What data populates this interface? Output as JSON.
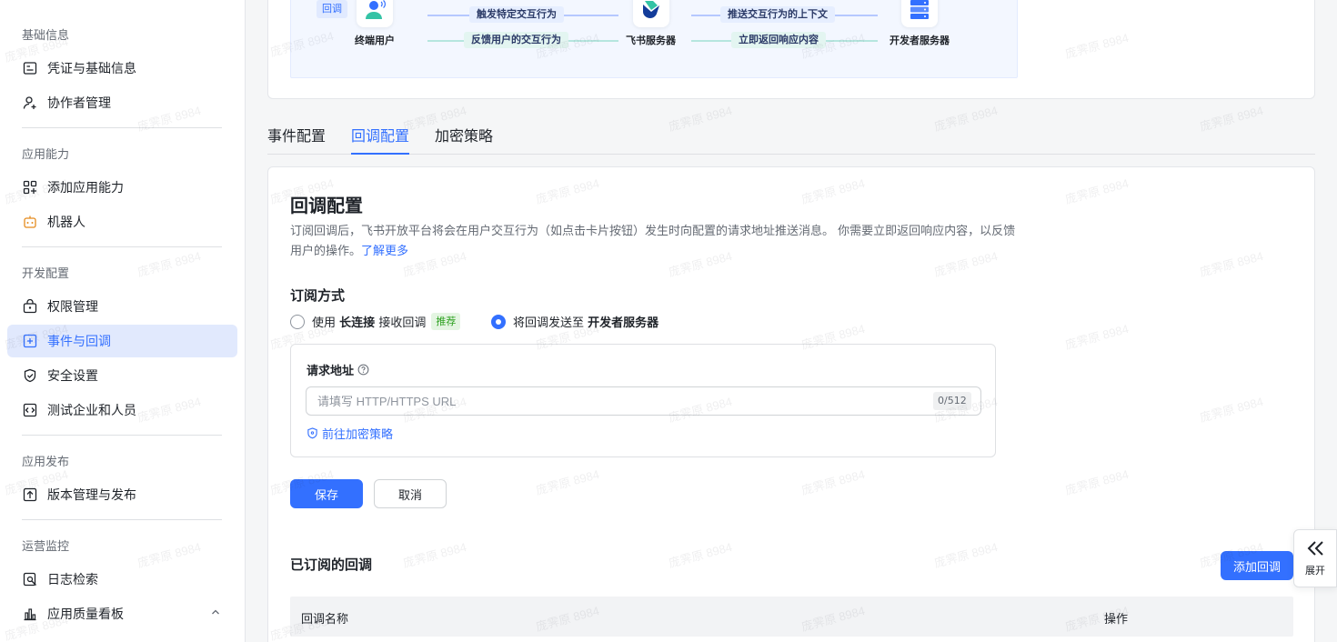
{
  "sidebar": {
    "groups": [
      {
        "title": "基础信息",
        "items": [
          {
            "label": "凭证与基础信息",
            "icon": "credential-icon"
          },
          {
            "label": "协作者管理",
            "icon": "user-add-icon"
          }
        ]
      },
      {
        "title": "应用能力",
        "items": [
          {
            "label": "添加应用能力",
            "icon": "apps-add-icon"
          },
          {
            "label": "机器人",
            "icon": "robot-icon"
          }
        ]
      },
      {
        "title": "开发配置",
        "items": [
          {
            "label": "权限管理",
            "icon": "permission-icon"
          },
          {
            "label": "事件与回调",
            "icon": "event-icon",
            "active": true
          },
          {
            "label": "安全设置",
            "icon": "shield-icon"
          },
          {
            "label": "测试企业和人员",
            "icon": "test-icon"
          }
        ]
      },
      {
        "title": "应用发布",
        "items": [
          {
            "label": "版本管理与发布",
            "icon": "upload-icon"
          }
        ]
      },
      {
        "title": "运营监控",
        "items": [
          {
            "label": "日志检索",
            "icon": "log-search-icon"
          },
          {
            "label": "应用质量看板",
            "icon": "chart-icon"
          }
        ]
      }
    ]
  },
  "flow": {
    "tag": "回调",
    "nodes": {
      "user": "终端用户",
      "feishu": "飞书服务器",
      "dev": "开发者服务器"
    },
    "arrows": {
      "trigger": "触发特定交互行为",
      "feedback": "反馈用户的交互行为",
      "push": "推送交互行为的上下文",
      "respond": "立即返回响应内容"
    }
  },
  "tabs": [
    {
      "label": "事件配置"
    },
    {
      "label": "回调配置",
      "active": true
    },
    {
      "label": "加密策略"
    }
  ],
  "config": {
    "title": "回调配置",
    "description": "订阅回调后，飞书开放平台将会在用户交互行为（如点击卡片按钮）发生时向配置的请求地址推送消息。 你需要立即返回响应内容，以反馈用户的操作。",
    "learn_more": "了解更多",
    "subscribe_title": "订阅方式",
    "option_long": {
      "prefix": "使用",
      "bold": "长连接",
      "suffix": "接收回调",
      "badge": "推荐"
    },
    "option_send": {
      "prefix": "将回调发送至",
      "bold": "开发者服务器"
    },
    "url": {
      "label": "请求地址",
      "placeholder": "请填写 HTTP/HTTPS URL",
      "count": "0/512",
      "link": "前往加密策略"
    },
    "save": "保存",
    "cancel": "取消",
    "subscribed_title": "已订阅的回调",
    "add_button": "添加回调",
    "table_headers": {
      "name": "回调名称",
      "action": "操作"
    }
  },
  "expand": {
    "label": "展开"
  },
  "watermark": "庞霁原 8984",
  "colors": {
    "accent": "#3370ff",
    "active_bg": "#e1e9fd"
  }
}
